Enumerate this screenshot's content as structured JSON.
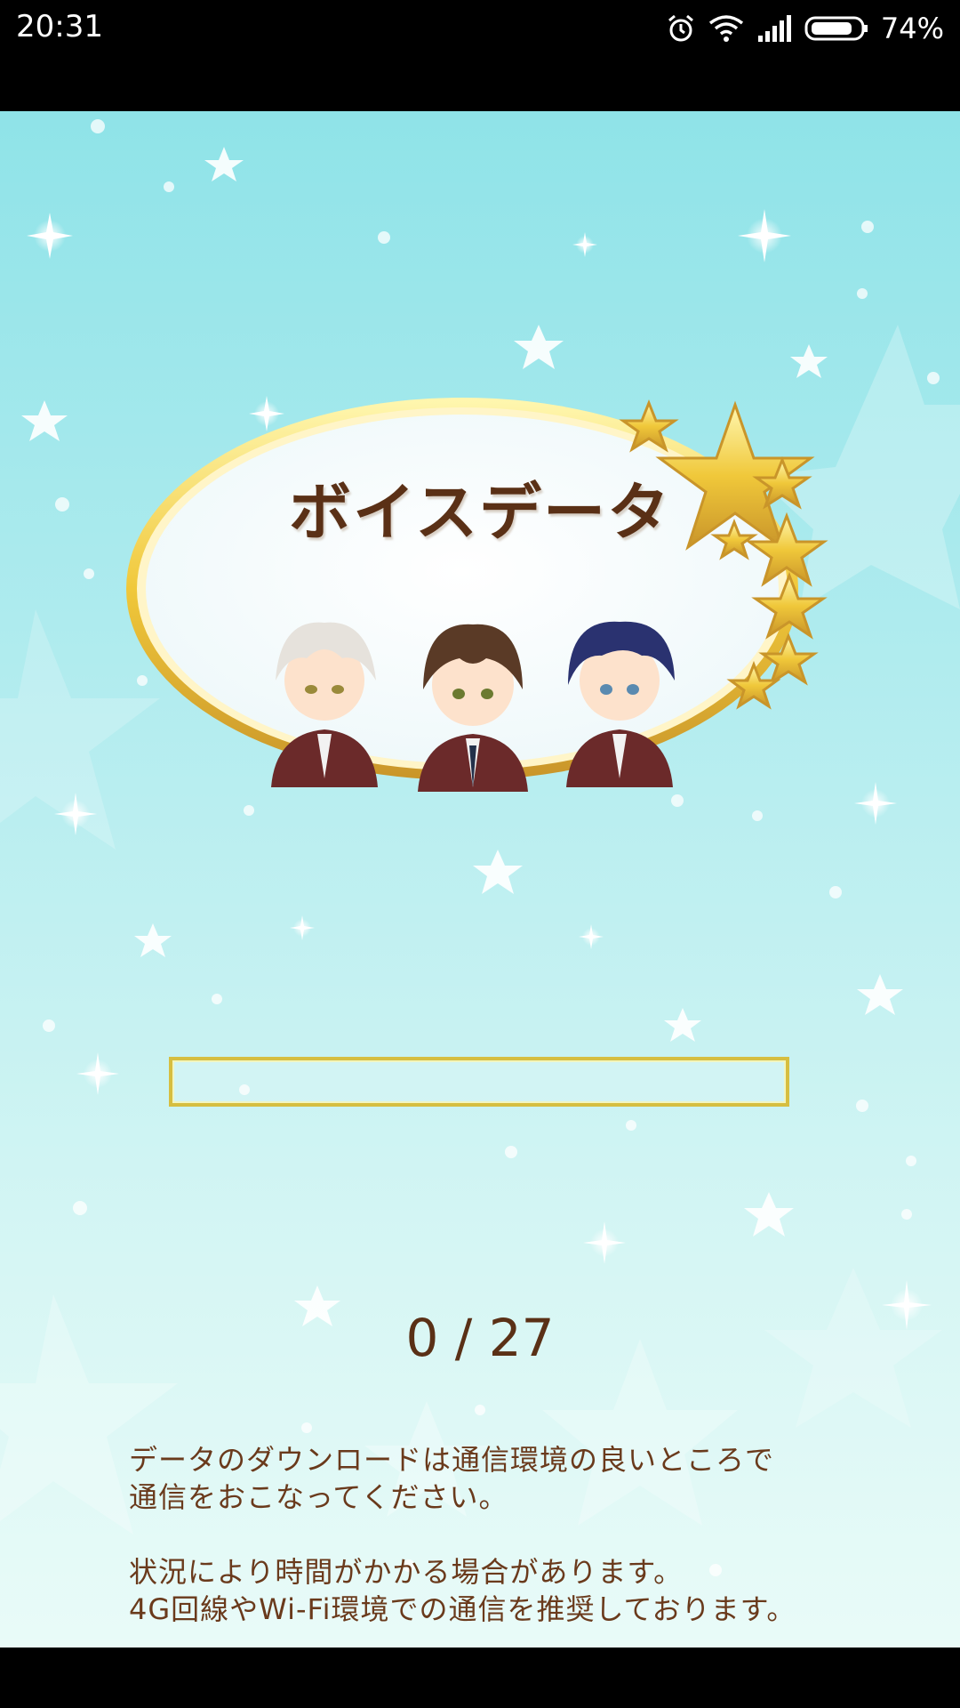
{
  "status_bar": {
    "time": "20:31",
    "battery_percent": "74%",
    "icons": [
      "alarm-icon",
      "wifi-icon",
      "signal-icon",
      "battery-icon"
    ]
  },
  "header": {
    "title": "ボイスデータ"
  },
  "characters": [
    "character-silver-hair",
    "character-brown-hair",
    "character-navy-hair"
  ],
  "progress": {
    "current": 0,
    "total": 27,
    "label": "0 / 27",
    "fraction": 0
  },
  "notice": {
    "line1": "データのダウンロードは通信環境の良いところで",
    "line2": "通信をおこなってください。",
    "line3": "状況により時間がかかる場合があります。",
    "line4": "4G回線やWi-Fi環境での通信を推奨しております。"
  },
  "colors": {
    "background_top": "#8fe3e8",
    "background_bottom": "#e9fbf8",
    "text_brown": "#5a3016",
    "gold": "#d6be40"
  }
}
